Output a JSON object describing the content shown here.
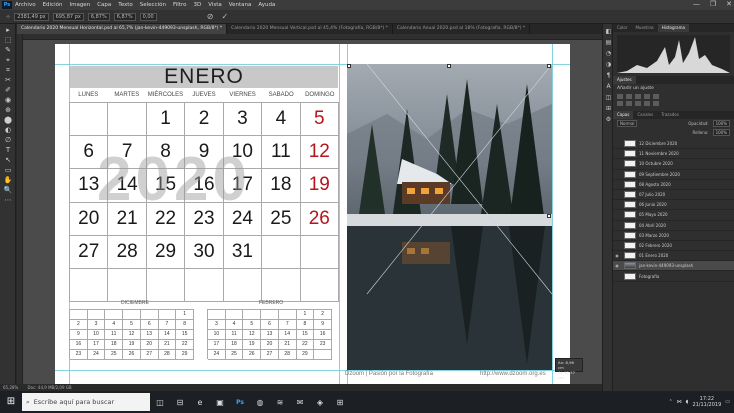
{
  "app": {
    "logo": "Ps"
  },
  "menu": [
    "Archivo",
    "Edición",
    "Imagen",
    "Capa",
    "Texto",
    "Selección",
    "Filtro",
    "3D",
    "Vista",
    "Ventana",
    "Ayuda"
  ],
  "window_controls": [
    "—",
    "❐",
    "✕"
  ],
  "options_bar": {
    "x_value": "2381,49 px",
    "y_value": "695,87 px",
    "w_value": "6,87%",
    "h_value": "6,87%",
    "angle_value": "0,00"
  },
  "doc_tabs": [
    {
      "label": "Calendario 2020 Mensual Horizontal.psd al 65,7% (jan-kevin-449093-unsplash, RGB/8*) *",
      "active": true
    },
    {
      "label": "Calendario 2020 Mensual Vertical.psd al 45,4% (Fotografía, RGB/8*) *",
      "active": false
    },
    {
      "label": "Calendario Anual 2020.psd al 18% (Fotografía, RGB/8*) *",
      "active": false
    }
  ],
  "tools": [
    "▸",
    "⬚",
    "✎",
    "⌖",
    "⌗",
    "✂",
    "✐",
    "◉",
    "⊕",
    "⬤",
    "◐",
    "∅",
    "T",
    "↖",
    "▭",
    "✋",
    "🔍",
    "⋯"
  ],
  "calendar": {
    "month": "ENERO",
    "year_watermark": "2020",
    "days": [
      "LUNES",
      "MARTES",
      "MIÉRCOLES",
      "JUEVES",
      "VIERNES",
      "SABADO",
      "DOMINGO"
    ],
    "cells": [
      "",
      "",
      "1",
      "2",
      "3",
      "4",
      "5",
      "6",
      "7",
      "8",
      "9",
      "10",
      "11",
      "12",
      "13",
      "14",
      "15",
      "16",
      "17",
      "18",
      "19",
      "20",
      "21",
      "22",
      "23",
      "24",
      "25",
      "26",
      "27",
      "28",
      "29",
      "30",
      "31",
      "",
      "",
      "",
      "",
      "",
      "",
      "",
      "",
      ""
    ],
    "sunday_color": "#b3161c",
    "mini_prev": {
      "label": "DICIEMBRE",
      "cells": [
        "",
        "",
        "",
        "",
        "",
        "",
        "1",
        "2",
        "3",
        "4",
        "5",
        "6",
        "7",
        "8",
        "9",
        "10",
        "11",
        "12",
        "13",
        "14",
        "15",
        "16",
        "17",
        "18",
        "19",
        "20",
        "21",
        "22",
        "23",
        "24",
        "25",
        "26",
        "27",
        "28",
        "29"
      ]
    },
    "mini_next": {
      "label": "FEBRERO",
      "cells": [
        "",
        "",
        "",
        "",
        "",
        "1",
        "2",
        "3",
        "4",
        "5",
        "6",
        "7",
        "8",
        "9",
        "10",
        "11",
        "12",
        "13",
        "14",
        "15",
        "16",
        "17",
        "18",
        "19",
        "20",
        "21",
        "22",
        "23",
        "24",
        "25",
        "26",
        "27",
        "28",
        "29",
        ""
      ]
    },
    "footer_left": "Dzoom | Pasión por la Fotografía",
    "footer_right": "http://www.dzoom.org.es"
  },
  "size_tooltip": {
    "line1": "An:   8,96 cm",
    "line2": "Al:   12,37 cm"
  },
  "status": {
    "zoom": "65,28%",
    "doc": "Doc: 44,9 MB/2,09 GB"
  },
  "panel_strip": [
    "◧",
    "▤",
    "◔",
    "◑",
    "¶",
    "A",
    "◫",
    "⊞",
    "⚙"
  ],
  "panels": {
    "top_tabs": [
      "Color",
      "Muestras",
      "Histograma"
    ],
    "adjust_tabs": [
      "Ajustes"
    ],
    "adjust_label": "Añadir un ajuste",
    "layer_tabs": [
      "Capas",
      "Canales",
      "Trazados"
    ],
    "blend_mode": "Normal",
    "opacity_label": "Opacidad:",
    "opacity_value": "100%",
    "fill_label": "Relleno:",
    "fill_value": "100%",
    "layers": [
      {
        "name": "12 Diciembre 2020",
        "visible": false,
        "active": false,
        "photo": false
      },
      {
        "name": "11 Noviembre 2020",
        "visible": false,
        "active": false,
        "photo": false
      },
      {
        "name": "10 Octubre 2020",
        "visible": false,
        "active": false,
        "photo": false
      },
      {
        "name": "09 Septiembre 2020",
        "visible": false,
        "active": false,
        "photo": false
      },
      {
        "name": "08 Agosto 2020",
        "visible": false,
        "active": false,
        "photo": false
      },
      {
        "name": "07 Julio 2020",
        "visible": false,
        "active": false,
        "photo": false
      },
      {
        "name": "06 Junio 2020",
        "visible": false,
        "active": false,
        "photo": false
      },
      {
        "name": "05 Mayo 2020",
        "visible": false,
        "active": false,
        "photo": false
      },
      {
        "name": "04 Abril 2020",
        "visible": false,
        "active": false,
        "photo": false
      },
      {
        "name": "03 Marzo 2020",
        "visible": false,
        "active": false,
        "photo": false
      },
      {
        "name": "02 Febrero 2020",
        "visible": false,
        "active": false,
        "photo": false
      },
      {
        "name": "01 Enero 2020",
        "visible": true,
        "active": false,
        "photo": false
      },
      {
        "name": "jan-kevin-449093-unsplash",
        "visible": true,
        "active": true,
        "photo": true
      },
      {
        "name": "Fotografía",
        "visible": false,
        "active": false,
        "photo": false
      }
    ]
  },
  "taskbar": {
    "search_placeholder": "Escribe aquí para buscar",
    "apps": [
      "◫",
      "⊟",
      "e",
      "▣",
      "Ps",
      "◍",
      "≋",
      "✉",
      "◈",
      "⊞"
    ],
    "time": "17:22",
    "date": "21/11/2019"
  }
}
